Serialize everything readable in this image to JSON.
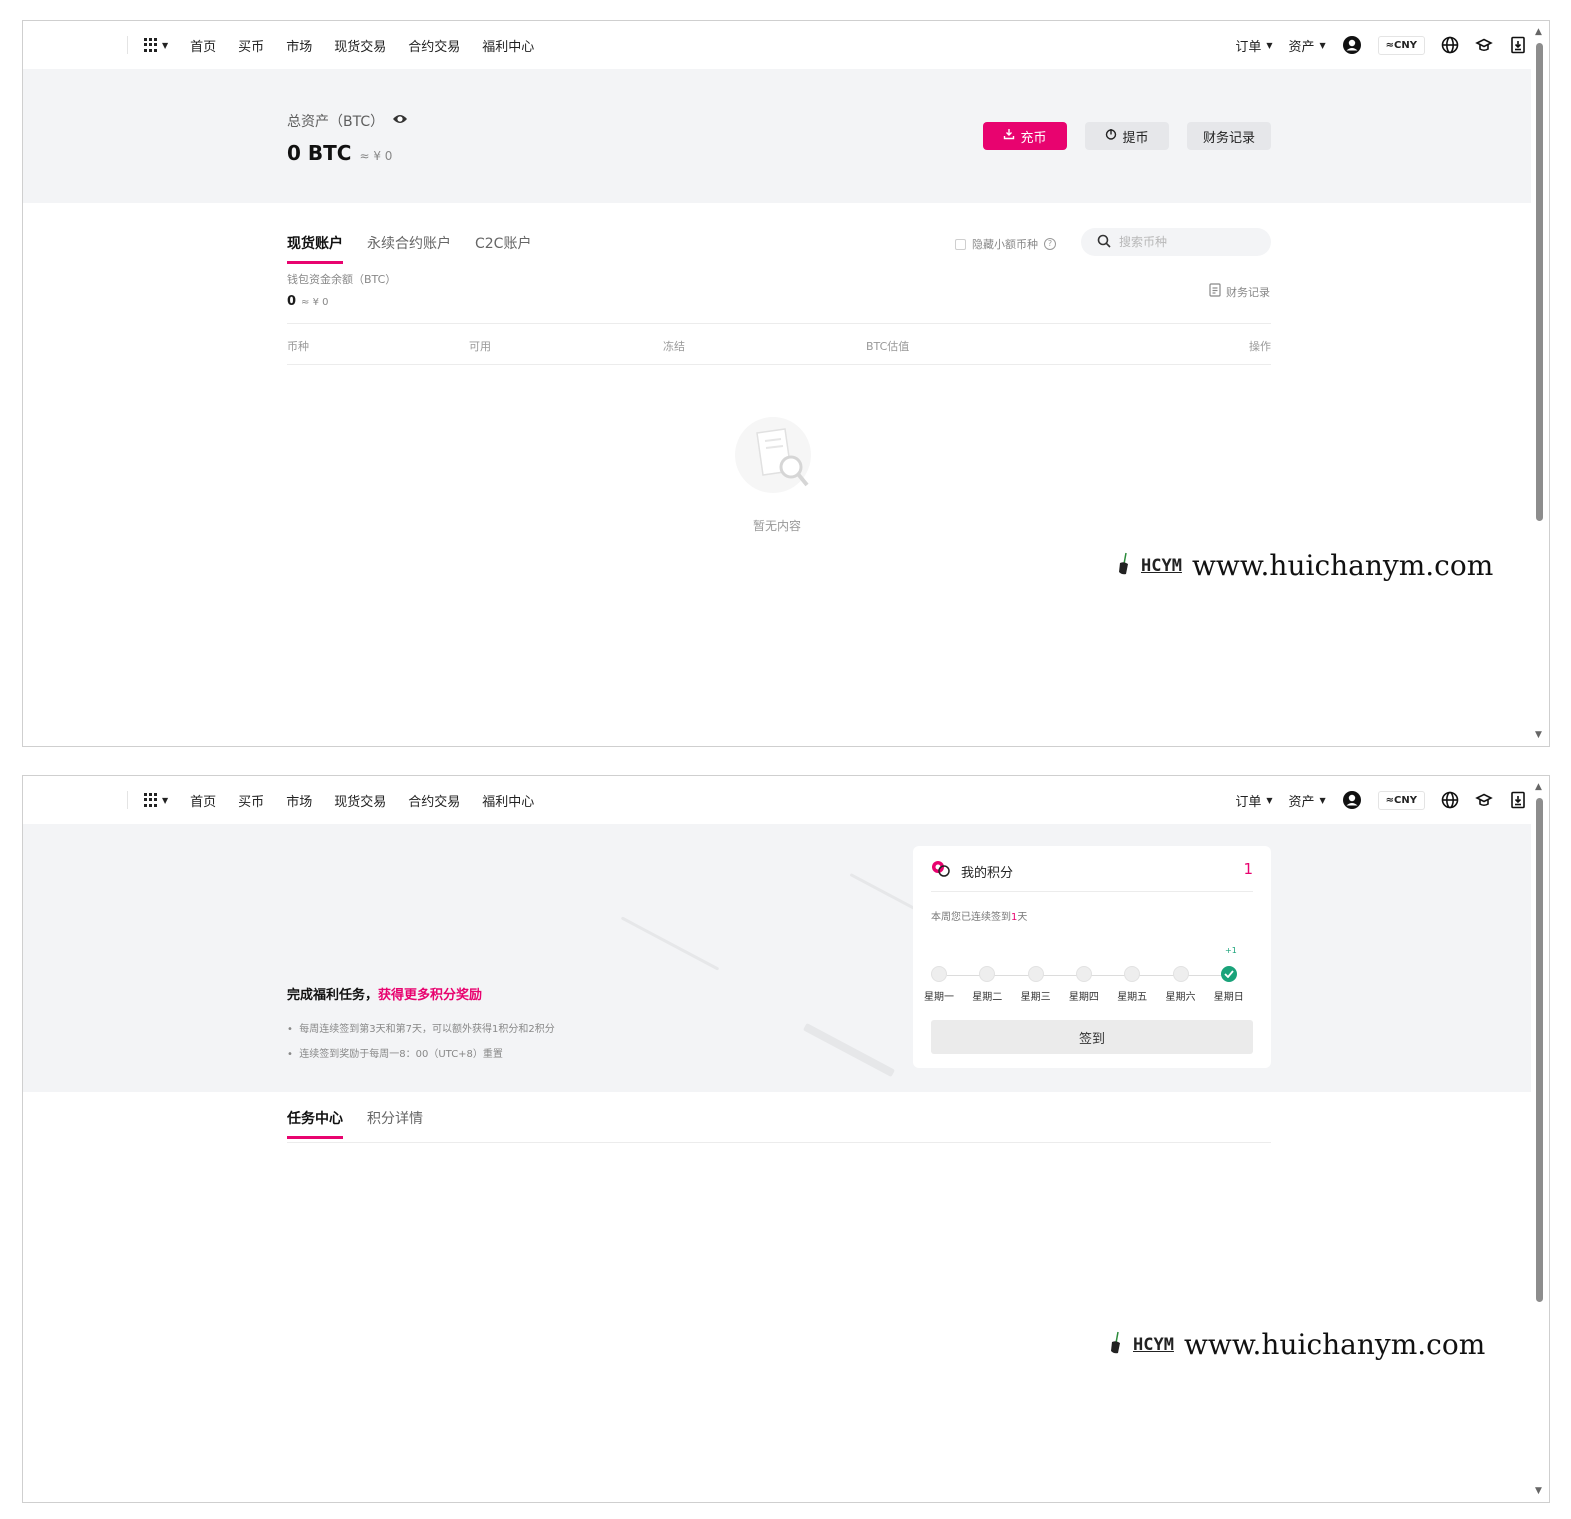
{
  "nav": {
    "menu": [
      "首页",
      "买币",
      "市场",
      "现货交易",
      "合约交易",
      "福利中心"
    ],
    "orders_label": "订单",
    "assets_label": "资产",
    "currency_label": "≈CNY"
  },
  "assets_page": {
    "total_title": "总资产（BTC）",
    "total_value": "0 BTC",
    "total_approx": "≈ ¥ 0",
    "deposit_label": "充币",
    "withdraw_label": "提币",
    "records_label": "财务记录",
    "tabs": [
      "现货账户",
      "永续合约账户",
      "C2C账户"
    ],
    "hide_small_label": "隐藏小额币种",
    "search_placeholder": "搜索币种",
    "wallet_label": "钱包资金余额（BTC）",
    "wallet_value": "0",
    "wallet_approx": "≈ ¥ 0",
    "fin_records_link": "财务记录",
    "table_headers": [
      "币种",
      "可用",
      "冻结",
      "BTC估值",
      "操作"
    ],
    "empty_text": "暂无内容"
  },
  "welfare_page": {
    "promo_title": "完成福利任务，",
    "promo_highlight": "获得更多积分奖励",
    "bullets": [
      "每周连续签到第3天和第7天，可以额外获得1积分和2积分",
      "连续签到奖励于每周一8：00（UTC+8）重置"
    ],
    "points_title": "我的积分",
    "points_value": "1",
    "streak_prefix": "本周您已连续签到",
    "streak_days": "1",
    "streak_suffix": "天",
    "bonus_label": "+1",
    "weekdays": [
      "星期一",
      "星期二",
      "星期三",
      "星期四",
      "星期五",
      "星期六",
      "星期日"
    ],
    "checked_days": [
      false,
      false,
      false,
      false,
      false,
      false,
      true
    ],
    "signin_label": "签到",
    "tabs": [
      "任务中心",
      "积分详情"
    ]
  },
  "watermark": {
    "badge": "HCYM",
    "url": "www.huichanym.com"
  },
  "colors": {
    "accent": "#e8036f",
    "success": "#1aa37a",
    "banner_bg": "#f3f4f6"
  }
}
